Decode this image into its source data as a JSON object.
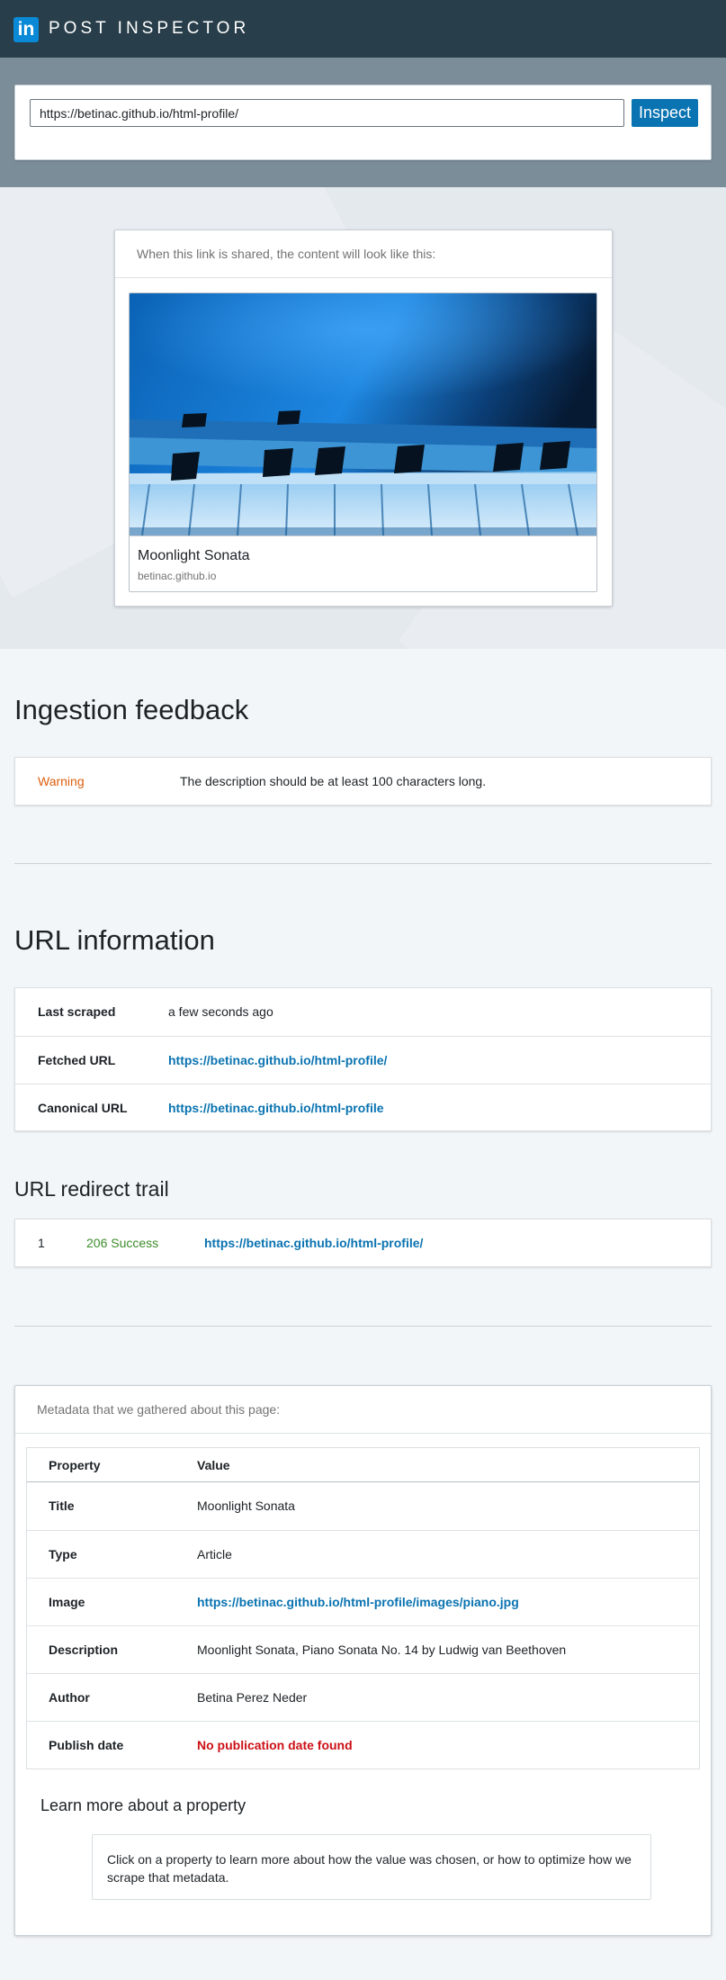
{
  "app": {
    "logo_text": "in",
    "title": "POST INSPECTOR"
  },
  "search": {
    "url_value": "https://betinac.github.io/html-profile/",
    "inspect_label": "Inspect"
  },
  "preview": {
    "caption": "When this link is shared, the content will look like this:",
    "title": "Moonlight Sonata",
    "domain": "betinac.github.io"
  },
  "ingestion": {
    "heading": "Ingestion feedback",
    "items": [
      {
        "level": "Warning",
        "message": "The description should be at least 100 characters long."
      }
    ]
  },
  "url_info": {
    "heading": "URL information",
    "rows": [
      {
        "label": "Last scraped",
        "value": "a few seconds ago"
      },
      {
        "label": "Fetched URL",
        "value": "https://betinac.github.io/html-profile/"
      },
      {
        "label": "Canonical URL",
        "value": "https://betinac.github.io/html-profile"
      }
    ]
  },
  "redirect": {
    "heading": "URL redirect trail",
    "items": [
      {
        "index": "1",
        "status": "206 Success",
        "url": "https://betinac.github.io/html-profile/"
      }
    ]
  },
  "metadata": {
    "caption": "Metadata that we gathered about this page:",
    "header": {
      "property": "Property",
      "value": "Value"
    },
    "rows": [
      {
        "property": "Title",
        "value": "Moonlight Sonata"
      },
      {
        "property": "Type",
        "value": "Article"
      },
      {
        "property": "Image",
        "value": "https://betinac.github.io/html-profile/images/piano.jpg"
      },
      {
        "property": "Description",
        "value": "Moonlight Sonata, Piano Sonata No. 14 by Ludwig van Beethoven"
      },
      {
        "property": "Author",
        "value": "Betina Perez Neder"
      },
      {
        "property": "Publish date",
        "value": "No publication date found"
      }
    ],
    "learn_title": "Learn more about a property",
    "learn_text": "Click on a property to learn more about how the value was chosen, or how to optimize how we scrape that metadata."
  },
  "colors": {
    "topbar": "#283e4a",
    "accent": "#0a73b1",
    "warning": "#dd5f0e",
    "success": "#3c8c2a",
    "error": "#cc1016"
  }
}
